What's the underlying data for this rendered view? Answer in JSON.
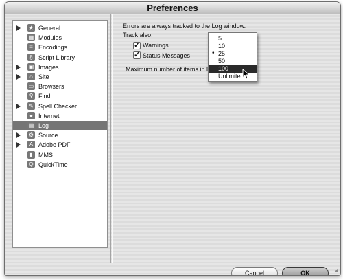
{
  "window": {
    "title": "Preferences"
  },
  "sidebar": {
    "items": [
      {
        "label": "General",
        "icon": "star-icon",
        "glyph": "★",
        "expandable": true,
        "selected": false
      },
      {
        "label": "Modules",
        "icon": "modules-icon",
        "glyph": "▦",
        "expandable": false,
        "selected": false
      },
      {
        "label": "Encodings",
        "icon": "encodings-icon",
        "glyph": "≡",
        "expandable": false,
        "selected": false
      },
      {
        "label": "Script Library",
        "icon": "script-library-icon",
        "glyph": "§",
        "expandable": false,
        "selected": false
      },
      {
        "label": "Images",
        "icon": "images-icon",
        "glyph": "▣",
        "expandable": true,
        "selected": false
      },
      {
        "label": "Site",
        "icon": "site-icon",
        "glyph": "⌂",
        "expandable": true,
        "selected": false
      },
      {
        "label": "Browsers",
        "icon": "browsers-icon",
        "glyph": "▭",
        "expandable": false,
        "selected": false
      },
      {
        "label": "Find",
        "icon": "find-icon",
        "glyph": "⚲",
        "expandable": false,
        "selected": false
      },
      {
        "label": "Spell Checker",
        "icon": "spell-checker-icon",
        "glyph": "✎",
        "expandable": true,
        "selected": false
      },
      {
        "label": "Internet",
        "icon": "globe-icon",
        "glyph": "●",
        "expandable": false,
        "selected": false
      },
      {
        "label": "Log",
        "icon": "log-icon",
        "glyph": "▤",
        "expandable": false,
        "selected": true
      },
      {
        "label": "Source",
        "icon": "source-icon",
        "glyph": "⚙",
        "expandable": true,
        "selected": false
      },
      {
        "label": "Adobe PDF",
        "icon": "adobe-pdf-icon",
        "glyph": "A",
        "expandable": true,
        "selected": false
      },
      {
        "label": "MMS",
        "icon": "phone-icon",
        "glyph": "▮",
        "expandable": false,
        "selected": false
      },
      {
        "label": "QuickTime",
        "icon": "quicktime-icon",
        "glyph": "Q",
        "expandable": false,
        "selected": false
      }
    ]
  },
  "log": {
    "info": "Errors are always tracked to the Log window.",
    "track_also": "Track also:",
    "warnings": {
      "label": "Warnings",
      "checked": true
    },
    "status_messages": {
      "label": "Status Messages",
      "checked": true
    },
    "max_items_label": "Maximum number of items in list"
  },
  "popup": {
    "options": [
      "5",
      "10",
      "25",
      "50",
      "100",
      "Unlimited"
    ],
    "selected": "25",
    "highlighted": "100"
  },
  "buttons": {
    "cancel": "Cancel",
    "ok": "OK"
  }
}
